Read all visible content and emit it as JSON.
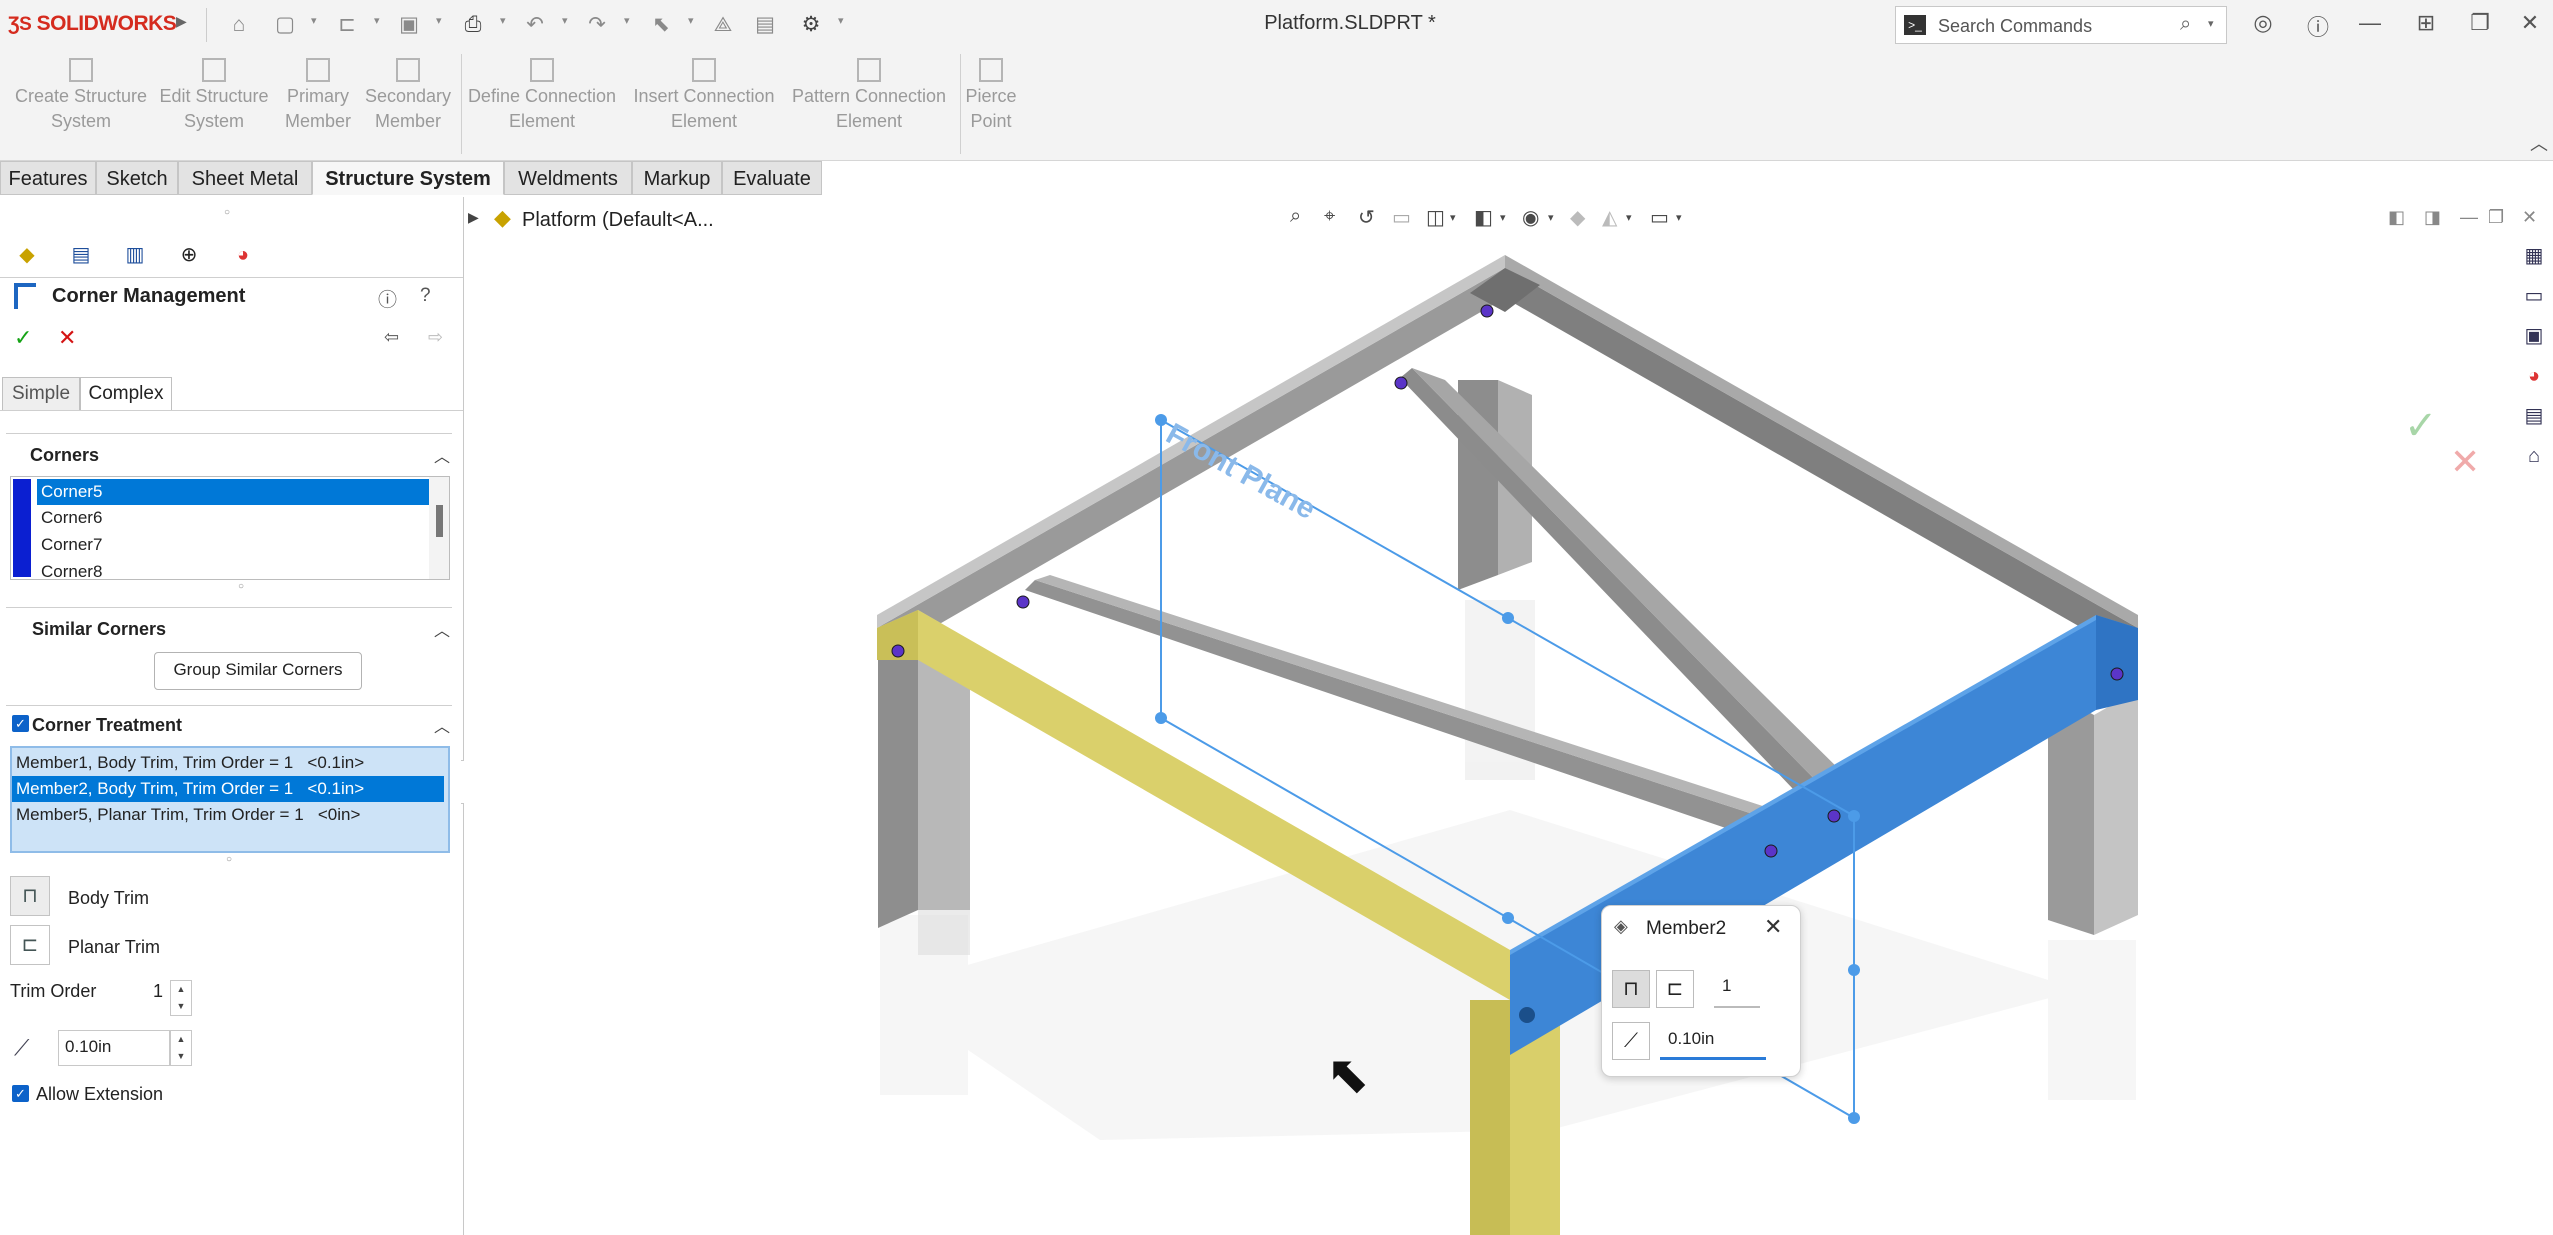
{
  "app": {
    "brand": "SOLIDWORKS",
    "doc_title": "Platform.SLDPRT *"
  },
  "search": {
    "placeholder": "Search Commands"
  },
  "command_manager": {
    "items": [
      {
        "line1": "Create Structure",
        "line2": "System"
      },
      {
        "line1": "Edit Structure",
        "line2": "System"
      },
      {
        "line1": "Primary",
        "line2": "Member"
      },
      {
        "line1": "Secondary",
        "line2": "Member"
      },
      {
        "line1": "Define Connection",
        "line2": "Element"
      },
      {
        "line1": "Insert Connection",
        "line2": "Element"
      },
      {
        "line1": "Pattern Connection",
        "line2": "Element"
      },
      {
        "line1": "Pierce",
        "line2": "Point"
      }
    ]
  },
  "tabs": [
    "Features",
    "Sketch",
    "Sheet Metal",
    "Structure System",
    "Weldments",
    "Markup",
    "Evaluate"
  ],
  "active_tab": "Structure System",
  "tree": {
    "root_label": "Platform (Default<A..."
  },
  "property_manager": {
    "title": "Corner Management",
    "mode_tabs": [
      "Simple",
      "Complex"
    ],
    "active_mode": "Complex",
    "corners": {
      "header": "Corners",
      "items": [
        "Corner5",
        "Corner6",
        "Corner7",
        "Corner8"
      ],
      "selected": "Corner5"
    },
    "similar": {
      "header": "Similar Corners",
      "button": "Group Similar Corners"
    },
    "treatment": {
      "header": "Corner Treatment",
      "checked": true,
      "items": [
        "Member1, Body Trim, Trim Order = 1   <0.1in>",
        "Member2, Body Trim, Trim Order = 1   <0.1in>",
        "Member5, Planar Trim, Trim Order = 1   <0in>"
      ],
      "selected_index": 1
    },
    "trim_types": {
      "body": "Body Trim",
      "planar": "Planar Trim"
    },
    "trim_order": {
      "label": "Trim Order",
      "value": "1"
    },
    "gap": {
      "value": "0.10in"
    },
    "allow_extension": {
      "label": "Allow Extension",
      "checked": true
    }
  },
  "scene": {
    "plane_label": "Front Plane"
  },
  "popup": {
    "title": "Member2",
    "order_value": "1",
    "gap_value": "0.10in"
  },
  "colors": {
    "accent": "#0078d7",
    "yellow_member": "#d9cf6a",
    "blue_member": "#3d86d6",
    "gray_member": "#8a8a8a",
    "corner_list_bar": "#0b1fd1",
    "treatment_bg": "#cde3f7"
  }
}
